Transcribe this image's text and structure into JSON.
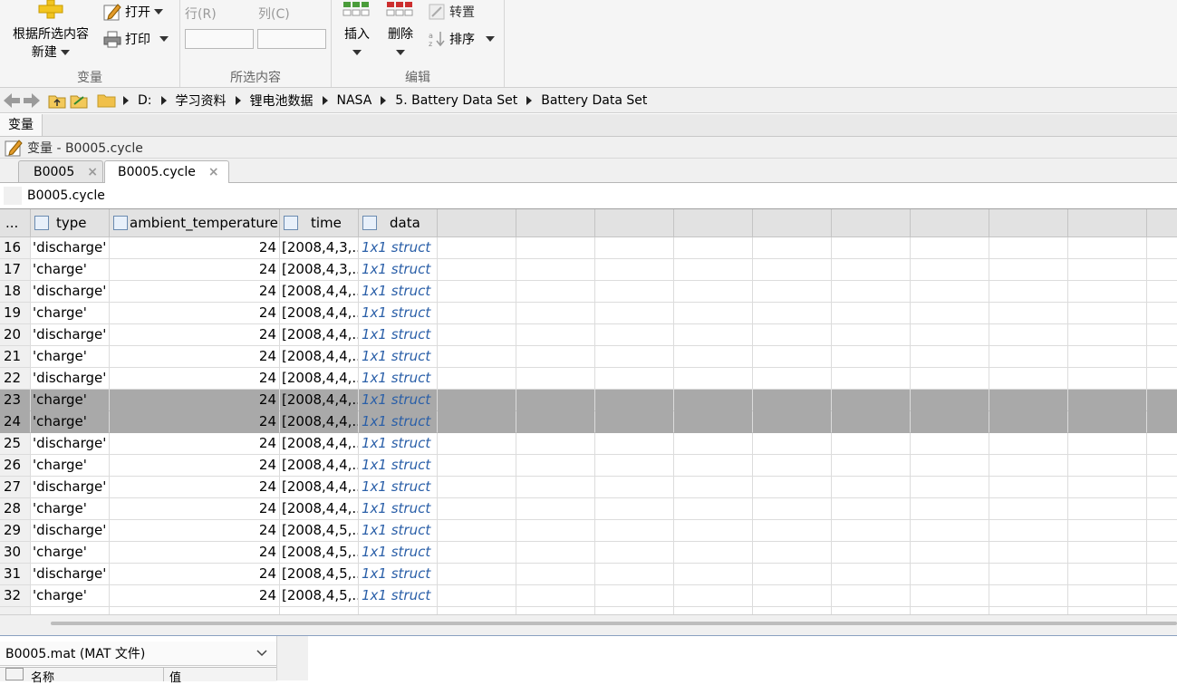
{
  "ribbon": {
    "variable_section": {
      "label": "变量",
      "new_label_1": "根据所选内容",
      "new_label_2": "新建",
      "open_label": "打开",
      "print_label": "打印"
    },
    "selection_section": {
      "label": "所选内容",
      "row_label": "行(R)",
      "col_label": "列(C)",
      "row_value": "",
      "col_value": ""
    },
    "edit_section": {
      "label": "编辑",
      "insert_label": "插入",
      "delete_label": "删除",
      "transpose_label": "转置",
      "sort_label": "排序"
    }
  },
  "address": {
    "crumbs": [
      "D:",
      "学习资料",
      "锂电池数据",
      "NASA",
      "5. Battery Data Set",
      "Battery Data Set"
    ]
  },
  "panel_tab": "变量",
  "var_title": "变量 - B0005.cycle",
  "doc_tabs": [
    {
      "label": "B0005",
      "active": false
    },
    {
      "label": "B0005.cycle",
      "active": true
    }
  ],
  "var_name": "B0005.cycle",
  "grid": {
    "corner": "...",
    "columns": [
      "type",
      "ambient_temperature",
      "time",
      "data"
    ],
    "rows": [
      {
        "n": "16",
        "type": "'discharge'",
        "temp": "24",
        "time": "[2008,4,3,...",
        "data": "1x1 struct"
      },
      {
        "n": "17",
        "type": "'charge'",
        "temp": "24",
        "time": "[2008,4,3,...",
        "data": "1x1 struct"
      },
      {
        "n": "18",
        "type": "'discharge'",
        "temp": "24",
        "time": "[2008,4,4,...",
        "data": "1x1 struct"
      },
      {
        "n": "19",
        "type": "'charge'",
        "temp": "24",
        "time": "[2008,4,4,...",
        "data": "1x1 struct"
      },
      {
        "n": "20",
        "type": "'discharge'",
        "temp": "24",
        "time": "[2008,4,4,...",
        "data": "1x1 struct"
      },
      {
        "n": "21",
        "type": "'charge'",
        "temp": "24",
        "time": "[2008,4,4,...",
        "data": "1x1 struct"
      },
      {
        "n": "22",
        "type": "'discharge'",
        "temp": "24",
        "time": "[2008,4,4,...",
        "data": "1x1 struct"
      },
      {
        "n": "23",
        "type": "'charge'",
        "temp": "24",
        "time": "[2008,4,4,...",
        "data": "1x1 struct"
      },
      {
        "n": "24",
        "type": "'charge'",
        "temp": "24",
        "time": "[2008,4,4,...",
        "data": "1x1 struct"
      },
      {
        "n": "25",
        "type": "'discharge'",
        "temp": "24",
        "time": "[2008,4,4,...",
        "data": "1x1 struct"
      },
      {
        "n": "26",
        "type": "'charge'",
        "temp": "24",
        "time": "[2008,4,4,...",
        "data": "1x1 struct"
      },
      {
        "n": "27",
        "type": "'discharge'",
        "temp": "24",
        "time": "[2008,4,4,...",
        "data": "1x1 struct"
      },
      {
        "n": "28",
        "type": "'charge'",
        "temp": "24",
        "time": "[2008,4,4,...",
        "data": "1x1 struct"
      },
      {
        "n": "29",
        "type": "'discharge'",
        "temp": "24",
        "time": "[2008,4,5,...",
        "data": "1x1 struct"
      },
      {
        "n": "30",
        "type": "'charge'",
        "temp": "24",
        "time": "[2008,4,5,...",
        "data": "1x1 struct"
      },
      {
        "n": "31",
        "type": "'discharge'",
        "temp": "24",
        "time": "[2008,4,5,...",
        "data": "1x1 struct"
      },
      {
        "n": "32",
        "type": "'charge'",
        "temp": "24",
        "time": "[2008,4,5,...",
        "data": "1x1 struct"
      }
    ],
    "selected_rows": [
      "23",
      "24"
    ]
  },
  "workspace": {
    "file_label": "B0005.mat  (MAT 文件)",
    "col_name": "名称",
    "col_value": "值"
  }
}
